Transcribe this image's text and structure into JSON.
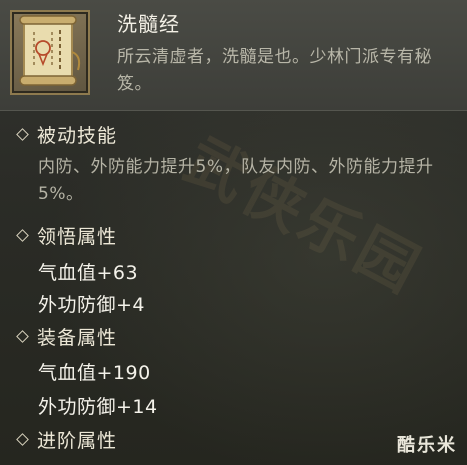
{
  "item": {
    "name": "洗髓经",
    "description": "所云清虚者，洗髓是也。少林门派专有秘笈。",
    "icon": "scroll-icon"
  },
  "sections": {
    "passive": {
      "title": "被动技能",
      "text": "内防、外防能力提升5%，队友内防、外防能力提升5%。"
    },
    "comprehension": {
      "title": "领悟属性",
      "stats": [
        "气血值+63",
        "外功防御+4"
      ]
    },
    "equipment": {
      "title": "装备属性",
      "stats": [
        "气血值+190",
        "外功防御+14"
      ]
    },
    "advanced": {
      "title": "进阶属性"
    }
  },
  "watermark": "武侠乐园",
  "logo": "酷乐米",
  "colors": {
    "title_text": "#f3f0e6",
    "desc_text": "#b8b6a8",
    "stat_text": "#f4f2ea",
    "icon_frame": "#8e7a4e"
  }
}
